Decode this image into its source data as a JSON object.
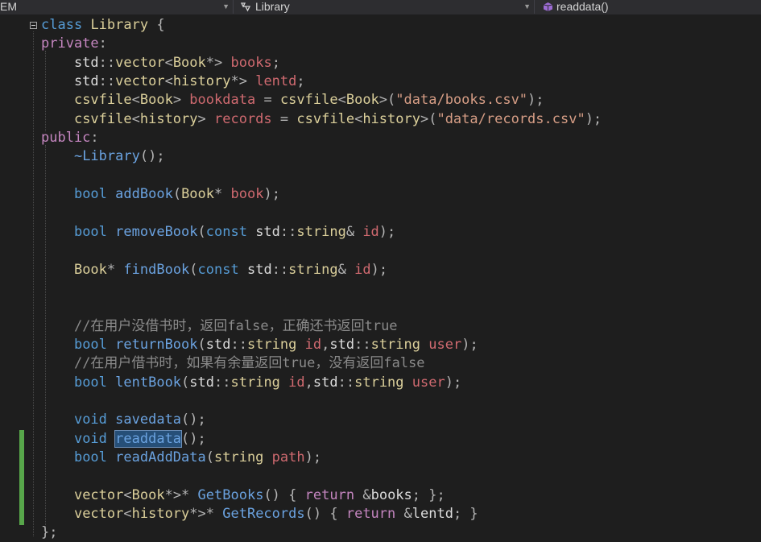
{
  "navbar": {
    "scope": "EM",
    "class_name": "Library",
    "member": "readdata()"
  },
  "code": [
    [
      [
        "kw2",
        "class"
      ],
      [
        "plain",
        " "
      ],
      [
        "typeY",
        "Library"
      ],
      [
        "plain",
        " "
      ],
      [
        "punct",
        "{"
      ]
    ],
    [
      [
        "kw",
        "private"
      ],
      [
        "punct",
        ":"
      ]
    ],
    [
      [
        "plain",
        "    std"
      ],
      [
        "punct",
        "::"
      ],
      [
        "typeY",
        "vector"
      ],
      [
        "punct",
        "<"
      ],
      [
        "typeY",
        "Book"
      ],
      [
        "punct",
        "*>"
      ],
      [
        "plain",
        " "
      ],
      [
        "member",
        "books"
      ],
      [
        "punct",
        ";"
      ]
    ],
    [
      [
        "plain",
        "    std"
      ],
      [
        "punct",
        "::"
      ],
      [
        "typeY",
        "vector"
      ],
      [
        "punct",
        "<"
      ],
      [
        "typeY",
        "history"
      ],
      [
        "punct",
        "*>"
      ],
      [
        "plain",
        " "
      ],
      [
        "member",
        "lentd"
      ],
      [
        "punct",
        ";"
      ]
    ],
    [
      [
        "plain",
        "    "
      ],
      [
        "typeY",
        "csvfile"
      ],
      [
        "punct",
        "<"
      ],
      [
        "typeY",
        "Book"
      ],
      [
        "punct",
        "> "
      ],
      [
        "member",
        "bookdata"
      ],
      [
        "plain",
        " "
      ],
      [
        "punct",
        "="
      ],
      [
        "plain",
        " "
      ],
      [
        "typeY",
        "csvfile"
      ],
      [
        "punct",
        "<"
      ],
      [
        "typeY",
        "Book"
      ],
      [
        "punct",
        ">("
      ],
      [
        "str",
        "\"data/books.csv\""
      ],
      [
        "punct",
        ");"
      ]
    ],
    [
      [
        "plain",
        "    "
      ],
      [
        "typeY",
        "csvfile"
      ],
      [
        "punct",
        "<"
      ],
      [
        "typeY",
        "history"
      ],
      [
        "punct",
        "> "
      ],
      [
        "member",
        "records"
      ],
      [
        "plain",
        " "
      ],
      [
        "punct",
        "="
      ],
      [
        "plain",
        " "
      ],
      [
        "typeY",
        "csvfile"
      ],
      [
        "punct",
        "<"
      ],
      [
        "typeY",
        "history"
      ],
      [
        "punct",
        ">("
      ],
      [
        "str",
        "\"data/records.csv\""
      ],
      [
        "punct",
        ");"
      ]
    ],
    [
      [
        "kw",
        "public"
      ],
      [
        "punct",
        ":"
      ]
    ],
    [
      [
        "plain",
        "    "
      ],
      [
        "fn",
        "~Library"
      ],
      [
        "punct",
        "();"
      ]
    ],
    [],
    [
      [
        "plain",
        "    "
      ],
      [
        "kw2",
        "bool"
      ],
      [
        "plain",
        " "
      ],
      [
        "fn",
        "addBook"
      ],
      [
        "punct",
        "("
      ],
      [
        "typeY",
        "Book"
      ],
      [
        "punct",
        "*"
      ],
      [
        "plain",
        " "
      ],
      [
        "member",
        "book"
      ],
      [
        "punct",
        ");"
      ]
    ],
    [],
    [
      [
        "plain",
        "    "
      ],
      [
        "kw2",
        "bool"
      ],
      [
        "plain",
        " "
      ],
      [
        "fn",
        "removeBook"
      ],
      [
        "punct",
        "("
      ],
      [
        "kw2",
        "const"
      ],
      [
        "plain",
        " std"
      ],
      [
        "punct",
        "::"
      ],
      [
        "typeY",
        "string"
      ],
      [
        "punct",
        "&"
      ],
      [
        "plain",
        " "
      ],
      [
        "member",
        "id"
      ],
      [
        "punct",
        ");"
      ]
    ],
    [],
    [
      [
        "plain",
        "    "
      ],
      [
        "typeY",
        "Book"
      ],
      [
        "punct",
        "*"
      ],
      [
        "plain",
        " "
      ],
      [
        "fn",
        "findBook"
      ],
      [
        "punct",
        "("
      ],
      [
        "kw2",
        "const"
      ],
      [
        "plain",
        " std"
      ],
      [
        "punct",
        "::"
      ],
      [
        "typeY",
        "string"
      ],
      [
        "punct",
        "&"
      ],
      [
        "plain",
        " "
      ],
      [
        "member",
        "id"
      ],
      [
        "punct",
        ");"
      ]
    ],
    [],
    [],
    [
      [
        "plain",
        "    "
      ],
      [
        "comment",
        "//在用户没借书时，返回false，正确还书返回true"
      ]
    ],
    [
      [
        "plain",
        "    "
      ],
      [
        "kw2",
        "bool"
      ],
      [
        "plain",
        " "
      ],
      [
        "fn",
        "returnBook"
      ],
      [
        "punct",
        "("
      ],
      [
        "plain",
        "std"
      ],
      [
        "punct",
        "::"
      ],
      [
        "typeY",
        "string"
      ],
      [
        "plain",
        " "
      ],
      [
        "member",
        "id"
      ],
      [
        "punct",
        ","
      ],
      [
        "plain",
        "std"
      ],
      [
        "punct",
        "::"
      ],
      [
        "typeY",
        "string"
      ],
      [
        "plain",
        " "
      ],
      [
        "member",
        "user"
      ],
      [
        "punct",
        ");"
      ]
    ],
    [
      [
        "plain",
        "    "
      ],
      [
        "comment",
        "//在用户借书时，如果有余量返回true，没有返回false"
      ]
    ],
    [
      [
        "plain",
        "    "
      ],
      [
        "kw2",
        "bool"
      ],
      [
        "plain",
        " "
      ],
      [
        "fn",
        "lentBook"
      ],
      [
        "punct",
        "("
      ],
      [
        "plain",
        "std"
      ],
      [
        "punct",
        "::"
      ],
      [
        "typeY",
        "string"
      ],
      [
        "plain",
        " "
      ],
      [
        "member",
        "id"
      ],
      [
        "punct",
        ","
      ],
      [
        "plain",
        "std"
      ],
      [
        "punct",
        "::"
      ],
      [
        "typeY",
        "string"
      ],
      [
        "plain",
        " "
      ],
      [
        "member",
        "user"
      ],
      [
        "punct",
        ");"
      ]
    ],
    [],
    [
      [
        "plain",
        "    "
      ],
      [
        "kw2",
        "void"
      ],
      [
        "plain",
        " "
      ],
      [
        "fn",
        "savedata"
      ],
      [
        "punct",
        "();"
      ]
    ],
    [
      [
        "plain",
        "    "
      ],
      [
        "kw2",
        "void"
      ],
      [
        "plain",
        " "
      ],
      [
        "fn",
        "readdata",
        "hl"
      ],
      [
        "punct",
        "();"
      ]
    ],
    [
      [
        "plain",
        "    "
      ],
      [
        "kw2",
        "bool"
      ],
      [
        "plain",
        " "
      ],
      [
        "fn",
        "readAddData"
      ],
      [
        "punct",
        "("
      ],
      [
        "typeY",
        "string"
      ],
      [
        "plain",
        " "
      ],
      [
        "member",
        "path"
      ],
      [
        "punct",
        ");"
      ]
    ],
    [],
    [
      [
        "plain",
        "    "
      ],
      [
        "typeY",
        "vector"
      ],
      [
        "punct",
        "<"
      ],
      [
        "typeY",
        "Book"
      ],
      [
        "punct",
        "*>*"
      ],
      [
        "plain",
        " "
      ],
      [
        "fn",
        "GetBooks"
      ],
      [
        "punct",
        "()"
      ],
      [
        "plain",
        " "
      ],
      [
        "punct",
        "{"
      ],
      [
        "plain",
        " "
      ],
      [
        "kw",
        "return"
      ],
      [
        "plain",
        " "
      ],
      [
        "punct",
        "&"
      ],
      [
        "plain",
        "books"
      ],
      [
        "punct",
        "; };"
      ]
    ],
    [
      [
        "plain",
        "    "
      ],
      [
        "typeY",
        "vector"
      ],
      [
        "punct",
        "<"
      ],
      [
        "typeY",
        "history"
      ],
      [
        "punct",
        "*>*"
      ],
      [
        "plain",
        " "
      ],
      [
        "fn",
        "GetRecords"
      ],
      [
        "punct",
        "()"
      ],
      [
        "plain",
        " "
      ],
      [
        "punct",
        "{"
      ],
      [
        "plain",
        " "
      ],
      [
        "kw",
        "return"
      ],
      [
        "plain",
        " "
      ],
      [
        "punct",
        "&"
      ],
      [
        "plain",
        "lentd"
      ],
      [
        "punct",
        "; }"
      ]
    ],
    [
      [
        "punct",
        "};"
      ]
    ]
  ]
}
